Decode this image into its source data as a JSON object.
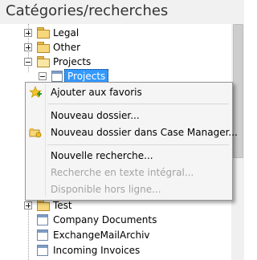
{
  "header": {
    "title": "Catégories/recherches"
  },
  "tree": {
    "items": [
      {
        "label": "Legal",
        "icon": "folder-icon",
        "expander": "plus"
      },
      {
        "label": "Other",
        "icon": "folder-icon",
        "expander": "plus"
      },
      {
        "label": "Projects",
        "icon": "folder-open-icon",
        "expander": "minus"
      },
      {
        "label": "Projects",
        "icon": "search-doc-icon",
        "expander": "minus",
        "selected": true
      },
      {
        "label": "Test",
        "icon": "folder-icon",
        "expander": "plus"
      },
      {
        "label": "Company Documents",
        "icon": "document-icon"
      },
      {
        "label": "ExchangeMailArchiv",
        "icon": "document-icon"
      },
      {
        "label": "Incoming Invoices",
        "icon": "document-icon"
      }
    ]
  },
  "context_menu": {
    "items": [
      {
        "label": "Ajouter aux favoris",
        "icon": "star-add-icon",
        "enabled": true
      },
      {
        "label": "Nouveau dossier...",
        "enabled": true
      },
      {
        "label": "Nouveau dossier dans Case Manager...",
        "icon": "case-folder-icon",
        "enabled": true
      },
      {
        "label": "Nouvelle recherche...",
        "enabled": true
      },
      {
        "label": "Recherche en texte intégral...",
        "enabled": false
      },
      {
        "label": "Disponible hors ligne...",
        "enabled": false
      }
    ]
  },
  "colors": {
    "header_bg": "#f1f1f1",
    "selection": "#3399ff",
    "disabled_text": "#a4a4a4",
    "folder": "#f7d77b"
  }
}
